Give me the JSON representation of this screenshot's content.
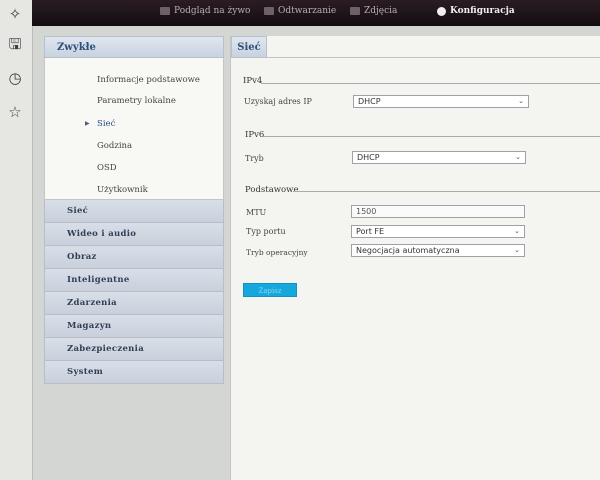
{
  "topnav": {
    "items": [
      {
        "label": "Podgląd na żywo",
        "icon": "monitor-icon"
      },
      {
        "label": "Odtwarzanie",
        "icon": "film-icon"
      },
      {
        "label": "Zdjęcia",
        "icon": "picture-icon"
      },
      {
        "label": "Konfiguracja",
        "icon": "gear-icon",
        "active": true
      }
    ]
  },
  "sidebar": {
    "header": "Zwykłe",
    "subitems": [
      "Informacje podstawowe",
      "Parametry lokalne",
      "Sieć",
      "Godzina",
      "OSD",
      "Użytkownik"
    ],
    "selected_subitem": "Sieć",
    "sections": [
      "Sieć",
      "Wideo i audio",
      "Obraz",
      "Inteligentne",
      "Zdarzenia",
      "Magazyn",
      "Zabezpieczenia",
      "System"
    ]
  },
  "main": {
    "tab": "Sieć",
    "ipv4": {
      "title": "IPv4",
      "label": "Uzyskaj adres IP",
      "value": "DHCP"
    },
    "ipv6": {
      "title": "IPv6",
      "label": "Tryb",
      "value": "DHCP"
    },
    "basic": {
      "title": "Podstawowe",
      "mtu_label": "MTU",
      "mtu_value": "1500",
      "port_type_label": "Typ portu",
      "port_type_value": "Port FE",
      "mode_label": "Tryb operacyjny",
      "mode_value": "Negocjacja automatyczna"
    },
    "save_label": "Zapisz"
  },
  "colors": {
    "accent_blue": "#16a8dd",
    "header_blue": "#2d4f7a",
    "topbar": "#1a1216"
  }
}
